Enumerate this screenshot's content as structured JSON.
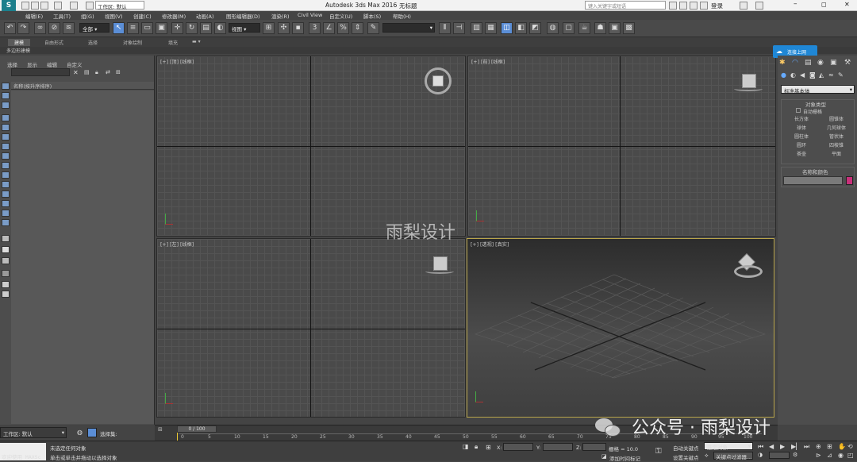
{
  "titlebar": {
    "workspace": "工作区: 默认",
    "app_title": "Autodesk 3ds Max 2016",
    "file_title": "无标题",
    "search_placeholder": "键入关键字或短语",
    "user": "登录"
  },
  "menu": [
    "编辑(E)",
    "工具(T)",
    "组(G)",
    "视图(V)",
    "创建(C)",
    "修改器(M)",
    "动画(A)",
    "图形编辑器(D)",
    "渲染(R)",
    "Civil View",
    "自定义(U)",
    "脚本(S)",
    "帮助(H)"
  ],
  "toolbar": {
    "selection_filter": "全部",
    "ref_coord": "视图",
    "named_selection": ""
  },
  "ribbon": {
    "tabs": [
      "建模",
      "自由形式",
      "选择",
      "对象绘制",
      "填充"
    ],
    "sub_label": "多边形建模"
  },
  "scene_explorer": {
    "tabs": [
      "选择",
      "显示",
      "编辑",
      "自定义"
    ],
    "column_header": "名称(按升序排序)"
  },
  "viewports": {
    "top": "[+] [顶] [线框]",
    "front": "[+] [前] [线框]",
    "left": "[+] [左] [线框]",
    "perspective": "[+] [透视] [真实]"
  },
  "command_panel": {
    "category_dropdown": "标准基本体",
    "section_object_type": "对象类型",
    "autogrid": "自动栅格",
    "buttons": [
      "长方体",
      "圆锥体",
      "球体",
      "几何球体",
      "圆柱体",
      "管状体",
      "圆环",
      "四棱锥",
      "茶壶",
      "平面"
    ],
    "section_name_color": "名称和颜色",
    "color": "#c8307a"
  },
  "timeline": {
    "frame_display": "0 / 100",
    "ticks": [
      "0",
      "5",
      "10",
      "15",
      "20",
      "25",
      "30",
      "35",
      "40",
      "45",
      "50",
      "55",
      "60",
      "65",
      "70",
      "75",
      "80",
      "85",
      "90",
      "95",
      "100"
    ]
  },
  "status": {
    "workspace": "工作区: 默认",
    "selection_set_label": "选择集:",
    "welcome": "欢迎使用 MAXSc",
    "msg1": "未选定任何对象",
    "msg2": "单击或单击并拖动以选择对象",
    "x_label": "X:",
    "y_label": "Y:",
    "z_label": "Z:",
    "grid": "栅格 = 10.0",
    "add_time_tag": "添加时间标记",
    "auto_key": "自动关键点",
    "set_key": "设置关键点",
    "selected_object": "选定对象",
    "key_filters": "关键点过滤器..."
  },
  "cloud_badge": "连接上网",
  "watermarks": {
    "center": "雨梨设计",
    "corner": "公众号 · 雨梨设计"
  }
}
